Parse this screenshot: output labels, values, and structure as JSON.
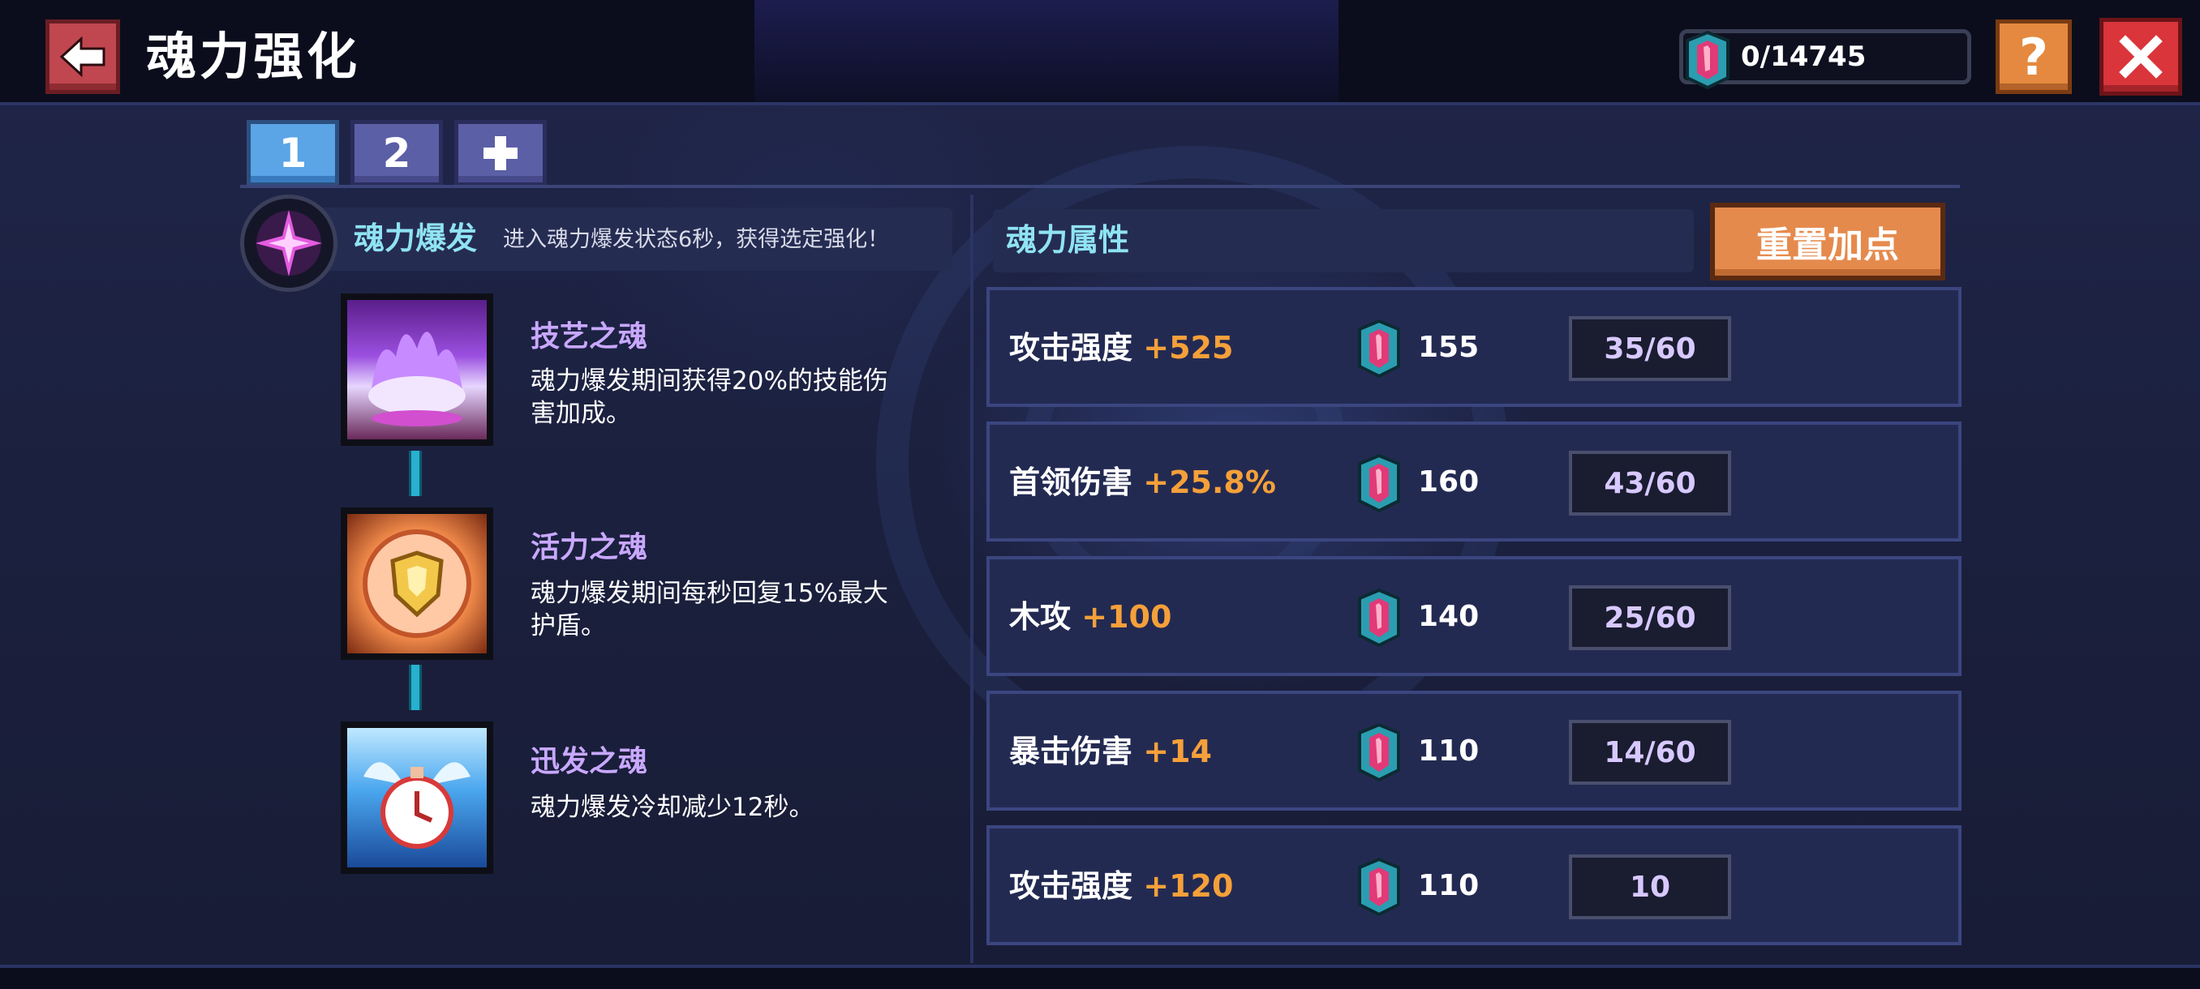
{
  "header": {
    "title": "魂力强化",
    "currency": "0/14745"
  },
  "tabs": [
    {
      "label": "1",
      "active": true
    },
    {
      "label": "2",
      "active": false
    },
    {
      "label": "+",
      "active": false
    }
  ],
  "burst": {
    "title": "魂力爆发",
    "description": "进入魂力爆发状态6秒，获得选定强化！"
  },
  "souls": [
    {
      "name": "技艺之魂",
      "description_lines": [
        "魂力爆发期间获得20%的技能伤",
        "害加成。"
      ],
      "icon": "purple-flame-icon"
    },
    {
      "name": "活力之魂",
      "description_lines": [
        "魂力爆发期间每秒回复15%最大",
        "护盾。"
      ],
      "icon": "golden-shield-icon"
    },
    {
      "name": "迅发之魂",
      "description_lines": [
        "魂力爆发冷却减少12秒。"
      ],
      "icon": "winged-clock-icon"
    }
  ],
  "attributes": {
    "header": "魂力属性",
    "reset_label": "重置加点",
    "rows": [
      {
        "name": "攻击强度",
        "bonus": "+525",
        "cost": "155",
        "level": "35/60"
      },
      {
        "name": "首领伤害",
        "bonus": "+25.8%",
        "cost": "160",
        "level": "43/60"
      },
      {
        "name": "木攻",
        "bonus": "+100",
        "cost": "140",
        "level": "25/60"
      },
      {
        "name": "暴击伤害",
        "bonus": "+14",
        "cost": "110",
        "level": "14/60"
      },
      {
        "name": "攻击强度",
        "bonus": "+120",
        "cost": "110",
        "level": "10"
      }
    ]
  },
  "colors": {
    "accent_cyan": "#8fe3f3",
    "bonus_orange": "#f5a03a",
    "soul_name_purple": "#c9a8ff",
    "tab_active": "#5ba4e6",
    "reset_button": "#e58a4d",
    "close_button": "#d9353b",
    "help_button": "#e4893f"
  }
}
